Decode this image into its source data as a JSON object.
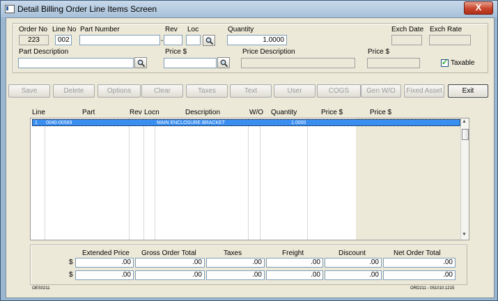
{
  "window": {
    "title": "Detail Billing Order Line Items Screen",
    "close_glyph": "X"
  },
  "header": {
    "order_no_label": "Order No",
    "order_no": "223",
    "line_no_label": "Line No",
    "line_no": "002",
    "part_number_label": "Part Number",
    "part_number": "",
    "dash": "-",
    "rev_label": "Rev",
    "rev": "",
    "loc_label": "Loc",
    "loc": "",
    "quantity_label": "Quantity",
    "quantity": "1.0000",
    "exch_date_label": "Exch Date",
    "exch_date": "",
    "exch_rate_label": "Exch Rate",
    "exch_rate": "",
    "part_description_label": "Part Description",
    "part_description": "",
    "price_label": "Price  $",
    "price": "",
    "price_description_label": "Price Description",
    "price_description": "",
    "price2_label": "Price $",
    "price2": "",
    "taxable_label": "Taxable"
  },
  "toolbar": {
    "save": "Save",
    "delete": "Delete",
    "options": "Options",
    "clear": "Clear",
    "taxes": "Taxes",
    "text": "Text",
    "user": "User",
    "cogs": "COGS",
    "gen_wo": "Gen W/O",
    "fixed_asset": "Fixed Asset",
    "exit": "Exit"
  },
  "grid": {
    "columns": [
      "Line",
      "Part",
      "Rev",
      "Locn",
      "Description",
      "W/O",
      "Quantity",
      "Price $",
      "Price $"
    ],
    "rows": [
      {
        "line": "1",
        "part": "0040-00569",
        "rev": "",
        "locn": "",
        "description": "MAIN ENCLOSURE BRACKET",
        "wo": "",
        "quantity": "1.0000",
        "price": "",
        "price2": ""
      }
    ]
  },
  "totals": {
    "headers": [
      "Extended Price",
      "Gross Order Total",
      "Taxes",
      "Freight",
      "Discount",
      "Net Order Total"
    ],
    "currency": "$",
    "row1": [
      ".00",
      ".00",
      ".00",
      ".00",
      ".00",
      ".00"
    ],
    "row2": [
      ".00",
      ".00",
      ".00",
      ".00",
      ".00",
      ".00"
    ]
  },
  "footer": {
    "left": "OES0211",
    "right": "ORD211 - 051010.1215"
  },
  "colors": {
    "selection": "#3a8ef0",
    "window_frame": "#9bb6cf",
    "close_button": "#c8452c",
    "checkmark": "#21a121"
  },
  "icons": {
    "lookup": "magnifier-icon",
    "close": "close-icon",
    "taxable": "checkbox-checked-icon"
  }
}
